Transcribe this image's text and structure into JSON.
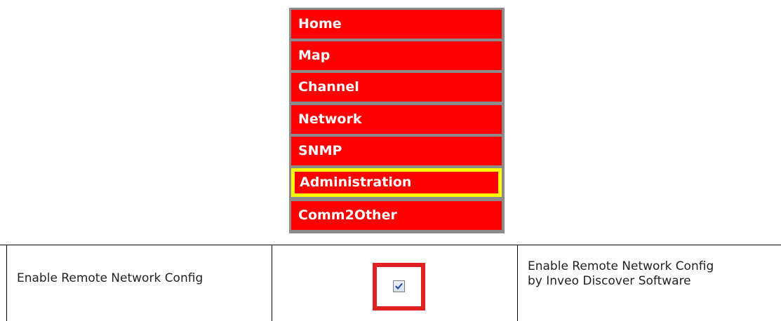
{
  "menu": {
    "items": [
      {
        "label": "Home"
      },
      {
        "label": "Map"
      },
      {
        "label": "Channel"
      },
      {
        "label": "Network"
      },
      {
        "label": "SNMP"
      },
      {
        "label": "Administration",
        "highlighted": true
      },
      {
        "label": "Comm2Other"
      }
    ]
  },
  "setting": {
    "label": "Enable Remote Network Config",
    "checked": true,
    "description": "Enable Remote Network Config by Inveo Discover Software"
  },
  "colors": {
    "menu_bg": "#ff0000",
    "menu_text": "#ffffff",
    "menu_border": "#8c8c8c",
    "highlight": "#ffff00",
    "checkbox_frame": "#e02020"
  }
}
